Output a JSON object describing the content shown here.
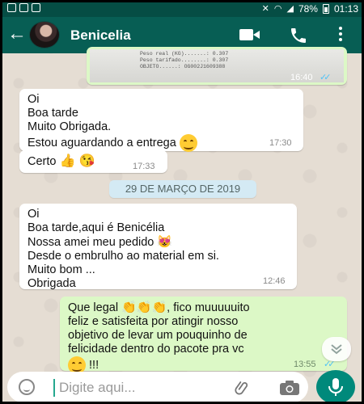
{
  "status_bar": {
    "battery": "78%",
    "time": "01:13"
  },
  "header": {
    "contact_name": "Benicelia",
    "back_icon": "arrow-left-icon",
    "video_icon": "video-call-icon",
    "call_icon": "phone-icon",
    "menu_icon": "more-vert-icon"
  },
  "messages": [
    {
      "direction": "outgoing",
      "type": "image",
      "image_lines": [
        "Peso real (KG).......:     0.307",
        "Peso tarifado........:     0.307",
        "OBJETO......: OG002J1609388"
      ],
      "time": "16:40",
      "status": "read"
    },
    {
      "direction": "incoming",
      "lines": [
        "Oi",
        "Boa tarde",
        "Muito Obrigada.",
        "Estou aguardando a entrega"
      ],
      "emoji": "smiling-face",
      "time": "17:30"
    },
    {
      "direction": "incoming",
      "lines": [
        "Certo"
      ],
      "emoji": "thumbs-up, kissing-face",
      "time": "17:33"
    },
    {
      "direction": "incoming",
      "lines": [
        "Oi",
        "Boa tarde,aqui é Benicélia",
        "Nossa amei meu pedido",
        "Desde o embrulho ao material em si.",
        "Muito bom ...",
        "Obrigada"
      ],
      "emoji": "heart-eyes-cat",
      "time": "12:46"
    },
    {
      "direction": "outgoing",
      "lines": [
        "Que legal",
        ", fico muuuuuito",
        "feliz e satisfeita por atingir nosso",
        "objetivo de levar um pouquinho de",
        "felicidade dentro do pacote pra vc",
        " !!!"
      ],
      "emoji": "clapping-hands x3, smiling-face",
      "time": "13:55",
      "status": "read"
    }
  ],
  "date_separator": "29 DE MARÇO DE 2019",
  "composer": {
    "placeholder": "Digite aqui...",
    "emoji_icon": "smiley-icon",
    "attach_icon": "paperclip-icon",
    "camera_icon": "camera-icon",
    "mic_icon": "microphone-icon"
  },
  "colors": {
    "header": "#075e54",
    "status_bar": "#054d44",
    "outgoing_bubble": "#dcf8c6",
    "incoming_bubble": "#ffffff",
    "date_chip": "#d4eaf4",
    "read_ticks": "#4fc3f7",
    "mic_button": "#00897b"
  }
}
